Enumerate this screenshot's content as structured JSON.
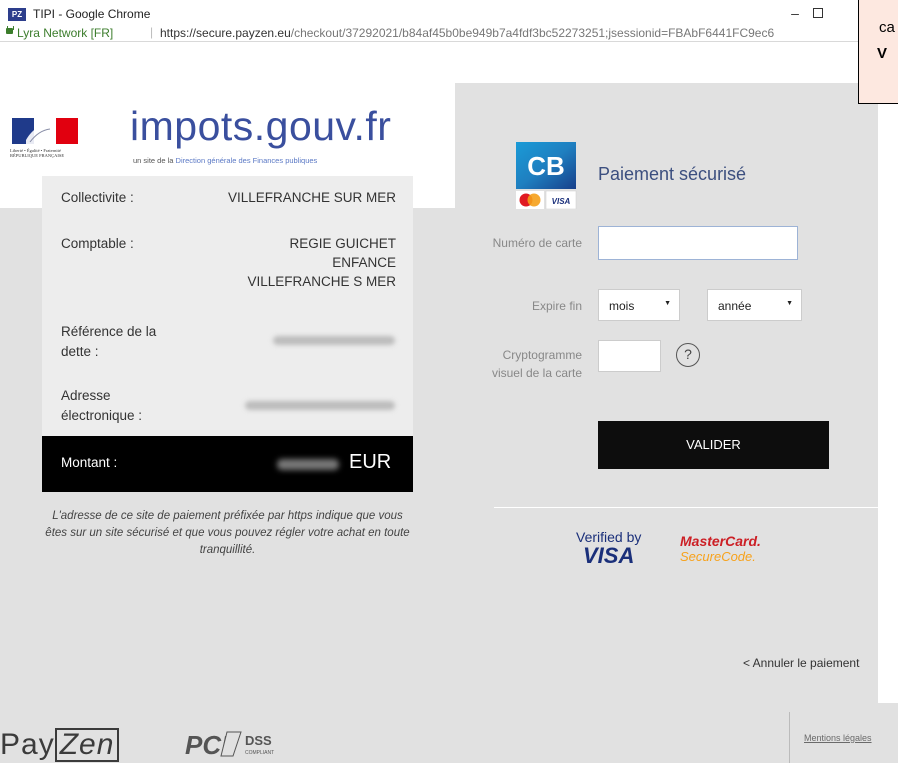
{
  "window": {
    "logo": "PZ",
    "title": "TIPI - Google Chrome",
    "minimize": "–"
  },
  "address_bar": {
    "org": "Lyra Network [FR]",
    "separator": "|",
    "url_host": "https://secure.payzen.eu",
    "url_path": "/checkout/37292021/b84af45b0be949b7a4fdf3bc52273251;jsessionid=FBAbF6441FC9ec6"
  },
  "header": {
    "brand": "impots.gouv.fr",
    "subtitle_prefix": "un site de la",
    "subtitle_main": "Direction générale des Finances publiques",
    "rf_line1": "Liberté • Égalité • Fraternité",
    "rf_line2": "RÉPUBLIQUE FRANÇAISE"
  },
  "info": {
    "collectivite_label": "Collectivite :",
    "collectivite_value": "VILLEFRANCHE SUR MER",
    "comptable_label": "Comptable :",
    "comptable_value_1": "REGIE GUICHET",
    "comptable_value_2": "ENFANCE",
    "comptable_value_3": "VILLEFRANCHE S MER",
    "reference_label_1": "Référence de la",
    "reference_label_2": "dette :",
    "adresse_label_1": "Adresse",
    "adresse_label_2": "électronique :",
    "montant_label": "Montant :",
    "montant_currency": "EUR",
    "note": "L'adresse de ce site de paiement préfixée par https indique que vous êtes sur un site sécurisé et que vous pouvez régler votre achat en toute tranquillité."
  },
  "payment": {
    "cb_text": "CB",
    "visa_small": "VISA",
    "title": "Paiement sécurisé",
    "card_number_label": "Numéro de carte",
    "expiry_label": "Expire fin",
    "month_placeholder": "mois",
    "year_placeholder": "année",
    "cvv_label": "Cryptogramme visuel de la carte",
    "help": "?",
    "submit": "VALIDER",
    "verified_by": "Verified by",
    "visa": "VISA",
    "mastercard": "MasterCard.",
    "securecode": "SecureCode.",
    "cancel": "< Annuler le paiement"
  },
  "footer": {
    "payzen_a": "Pay",
    "payzen_b": "Zen",
    "pci": "PCI",
    "dss": "DSS",
    "compliant": "COMPLIANT",
    "mentions": "Mentions légales"
  },
  "overlay": {
    "line1": "ca",
    "line2": "V"
  },
  "colors": {
    "brand_blue": "#3a4f9e",
    "button_black": "#0d0d0d",
    "page_grey": "#e1e1e1",
    "mastercard_red": "#cc1f25",
    "securecode_orange": "#f7a21c"
  }
}
